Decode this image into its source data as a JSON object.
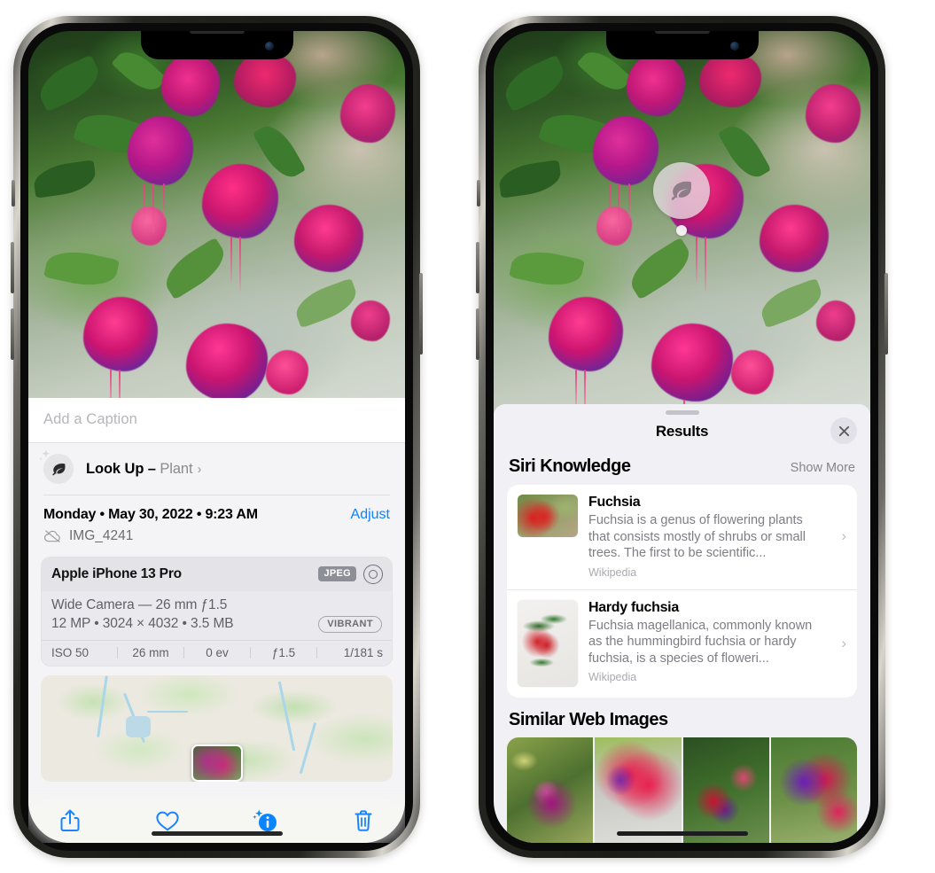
{
  "left_phone": {
    "photo": {
      "alt": "fuchsia-flowers-photo"
    },
    "caption": {
      "placeholder": "Add a Caption",
      "value": ""
    },
    "lookup": {
      "icon": "leaf-icon",
      "sparkle_icon": "sparkle-icon",
      "label": "Look Up",
      "separator": "–",
      "subject": "Plant",
      "chevron": "›"
    },
    "metadata": {
      "date_line": "Monday • May 30, 2022 • 9:23 AM",
      "adjust_label": "Adjust",
      "cloud_icon": "cloud-slash-icon",
      "file_name": "IMG_4241"
    },
    "camera_card": {
      "model": "Apple iPhone 13 Pro",
      "format_badge": "JPEG",
      "aperture_icon": "aperture-icon",
      "lens_line": "Wide Camera — 26 mm ƒ1.5",
      "specs_line": "12 MP • 3024 × 4032 • 3.5 MB",
      "style_badge": "VIBRANT",
      "exif": [
        "ISO 50",
        "26 mm",
        "0 ev",
        "ƒ1.5",
        "1/181 s"
      ]
    },
    "map": {
      "pin_label": "photo-location-pin"
    },
    "toolbar": [
      {
        "name": "share-button",
        "icon": "share-icon"
      },
      {
        "name": "favorite-button",
        "icon": "heart-icon"
      },
      {
        "name": "info-button",
        "icon": "info-sparkle-icon"
      },
      {
        "name": "delete-button",
        "icon": "trash-icon"
      }
    ]
  },
  "right_phone": {
    "photo": {
      "alt": "fuchsia-flowers-photo"
    },
    "badge": {
      "icon": "leaf-icon"
    },
    "sheet": {
      "title": "Results",
      "close_icon": "close-icon",
      "siri_section": {
        "title": "Siri Knowledge",
        "action": "Show More",
        "cards": [
          {
            "title": "Fuchsia",
            "description": "Fuchsia is a genus of flowering plants that consists mostly of shrubs or small trees. The first to be scientific...",
            "source": "Wikipedia",
            "chevron": "›",
            "thumb": "fuchsia-red-flowers-thumb"
          },
          {
            "title": "Hardy fuchsia",
            "description": "Fuchsia magellanica, commonly known as the hummingbird fuchsia or hardy fuchsia, is a species of floweri...",
            "source": "Wikipedia",
            "chevron": "›",
            "thumb": "hardy-fuchsia-branch-thumb"
          }
        ]
      },
      "web_section": {
        "title": "Similar Web Images",
        "images": [
          "web-image-1",
          "web-image-2",
          "web-image-3",
          "web-image-4"
        ]
      }
    }
  },
  "colors": {
    "accent_blue": "#0a84ff",
    "sheet_bg_left": "#f4f4f6",
    "sheet_bg_right": "#f1f0f5",
    "card_bg": "#ffffff",
    "secondary_text": "#7d7d84"
  }
}
